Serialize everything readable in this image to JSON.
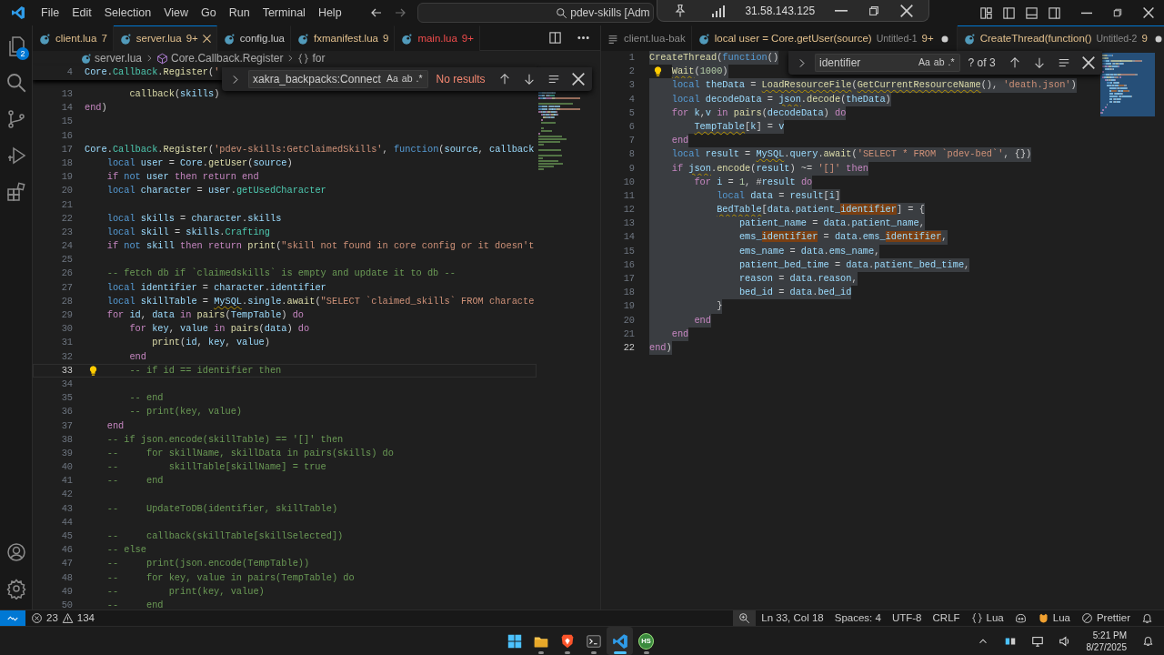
{
  "title_bar": {
    "menu": [
      "File",
      "Edit",
      "Selection",
      "View",
      "Go",
      "Run",
      "Terminal",
      "Help"
    ],
    "search": "pdev-skills [Adm"
  },
  "remote_toolbar": {
    "address": "31.58.143.125"
  },
  "activity_bar": {
    "items": [
      {
        "kind": "explorer",
        "badge": "2"
      },
      {
        "kind": "search"
      },
      {
        "kind": "scm"
      },
      {
        "kind": "debug"
      },
      {
        "kind": "extensions"
      }
    ],
    "bottom": [
      {
        "kind": "account"
      },
      {
        "kind": "settings"
      }
    ]
  },
  "left_editor": {
    "tabs": [
      {
        "kind": "warning",
        "label": "client.lua",
        "badge": "7",
        "modified": false,
        "selected": false
      },
      {
        "kind": "warning",
        "label": "server.lua",
        "badge": "9+",
        "modified": false,
        "selected": true
      },
      {
        "kind": "clean",
        "label": "config.lua",
        "modified": false,
        "selected": false
      },
      {
        "kind": "warning",
        "label": "fxmanifest.lua",
        "badge": "9",
        "modified": false,
        "selected": false
      },
      {
        "kind": "error",
        "label": "main.lua",
        "badge": "9+",
        "modified": false,
        "selected": false
      }
    ],
    "breadcrumb": [
      {
        "kind": "file",
        "label": "server.lua"
      },
      {
        "kind": "class",
        "label": "Core.Callback.Register"
      },
      {
        "kind": "block",
        "label": "for"
      }
    ],
    "find": {
      "query": "xakra_backpacks:Connect",
      "options": [
        "Aa",
        "ab",
        ".*"
      ],
      "status": "No results",
      "found": false
    },
    "selection": false,
    "sticky": {
      "num": "4",
      "current": false,
      "bulb": false,
      "t": [
        {
          "kind": "var",
          "text": "Core"
        },
        {
          "kind": "pun",
          "text": "."
        },
        {
          "kind": "mem",
          "text": "Callback"
        },
        {
          "kind": "pun",
          "text": "."
        },
        {
          "kind": "fn",
          "text": "Register"
        },
        {
          "kind": "pun",
          "text": "("
        },
        {
          "kind": "str",
          "text": "'"
        }
      ]
    },
    "lines": [
      {
        "num": "13",
        "current": false,
        "bulb": false,
        "t": [
          {
            "kind": "fn",
            "text": "        callback"
          },
          {
            "kind": "pun",
            "text": "("
          },
          {
            "kind": "var",
            "text": "skills"
          },
          {
            "kind": "pun",
            "text": ")"
          }
        ]
      },
      {
        "num": "14",
        "current": false,
        "bulb": false,
        "t": [
          {
            "kind": "kw",
            "text": "end"
          },
          {
            "kind": "pun",
            "text": ")"
          }
        ]
      },
      {
        "num": "15",
        "current": false,
        "bulb": false
      },
      {
        "num": "16",
        "current": false,
        "bulb": false
      },
      {
        "num": "17",
        "current": false,
        "bulb": false,
        "t": [
          {
            "kind": "var",
            "text": "Core"
          },
          {
            "kind": "pun",
            "text": "."
          },
          {
            "kind": "mem",
            "text": "Callback"
          },
          {
            "kind": "pun",
            "text": "."
          },
          {
            "kind": "fn",
            "text": "Register"
          },
          {
            "kind": "pun",
            "text": "("
          },
          {
            "kind": "str",
            "text": "'pdev-skills:GetClaimedSkills'"
          },
          {
            "kind": "pun",
            "text": ", "
          },
          {
            "kind": "st",
            "text": "function"
          },
          {
            "kind": "pun",
            "text": "("
          },
          {
            "kind": "var",
            "text": "source"
          },
          {
            "kind": "pun",
            "text": ", "
          },
          {
            "kind": "var",
            "text": "callback"
          }
        ]
      },
      {
        "num": "18",
        "current": false,
        "bulb": false,
        "t": [
          {
            "kind": "st",
            "text": "    local "
          },
          {
            "kind": "var",
            "text": "user"
          },
          {
            "kind": "pun",
            "text": " = "
          },
          {
            "kind": "var",
            "text": "Core"
          },
          {
            "kind": "pun",
            "text": "."
          },
          {
            "kind": "fn",
            "text": "getUser"
          },
          {
            "kind": "pun",
            "text": "("
          },
          {
            "kind": "var",
            "text": "source"
          },
          {
            "kind": "pun",
            "text": ")"
          }
        ]
      },
      {
        "num": "19",
        "current": false,
        "bulb": false,
        "t": [
          {
            "kind": "kw",
            "text": "    if "
          },
          {
            "kind": "st",
            "text": "not "
          },
          {
            "kind": "var",
            "text": "user "
          },
          {
            "kind": "kw",
            "text": "then return end"
          }
        ]
      },
      {
        "num": "20",
        "current": false,
        "bulb": false,
        "t": [
          {
            "kind": "st",
            "text": "    local "
          },
          {
            "kind": "var",
            "text": "character"
          },
          {
            "kind": "pun",
            "text": " = "
          },
          {
            "kind": "var",
            "text": "user"
          },
          {
            "kind": "pun",
            "text": "."
          },
          {
            "kind": "mem",
            "text": "getUsedCharacter"
          }
        ]
      },
      {
        "num": "21",
        "current": false,
        "bulb": false
      },
      {
        "num": "22",
        "current": false,
        "bulb": false,
        "t": [
          {
            "kind": "st",
            "text": "    local "
          },
          {
            "kind": "var",
            "text": "skills"
          },
          {
            "kind": "pun",
            "text": " = "
          },
          {
            "kind": "var",
            "text": "character"
          },
          {
            "kind": "pun",
            "text": "."
          },
          {
            "kind": "var",
            "text": "skills"
          }
        ]
      },
      {
        "num": "23",
        "current": false,
        "bulb": false,
        "t": [
          {
            "kind": "st",
            "text": "    local "
          },
          {
            "kind": "var",
            "text": "skill"
          },
          {
            "kind": "pun",
            "text": " = "
          },
          {
            "kind": "var",
            "text": "skills"
          },
          {
            "kind": "pun",
            "text": "."
          },
          {
            "kind": "mem",
            "text": "Crafting"
          }
        ]
      },
      {
        "num": "24",
        "current": false,
        "bulb": false,
        "t": [
          {
            "kind": "kw",
            "text": "    if "
          },
          {
            "kind": "st",
            "text": "not "
          },
          {
            "kind": "var",
            "text": "skill "
          },
          {
            "kind": "kw",
            "text": "then return "
          },
          {
            "kind": "fn",
            "text": "print"
          },
          {
            "kind": "pun",
            "text": "("
          },
          {
            "kind": "str",
            "text": "\"skill not found in core config or it doesn't"
          }
        ]
      },
      {
        "num": "25",
        "current": false,
        "bulb": false
      },
      {
        "num": "26",
        "current": false,
        "bulb": false,
        "t": [
          {
            "kind": "com",
            "text": "    -- fetch db if `claimedskills` is empty and update it to db --"
          }
        ]
      },
      {
        "num": "27",
        "current": false,
        "bulb": false,
        "t": [
          {
            "kind": "st",
            "text": "    local "
          },
          {
            "kind": "var",
            "text": "identifier"
          },
          {
            "kind": "pun",
            "text": " = "
          },
          {
            "kind": "var",
            "text": "character"
          },
          {
            "kind": "pun",
            "text": "."
          },
          {
            "kind": "var",
            "text": "identifier"
          }
        ]
      },
      {
        "num": "28",
        "current": false,
        "bulb": false,
        "t": [
          {
            "kind": "st",
            "text": "    local "
          },
          {
            "kind": "var",
            "text": "skillTable"
          },
          {
            "kind": "pun",
            "text": " = "
          },
          {
            "kind": "var",
            "text": "MySQL",
            "squiggle": true
          },
          {
            "kind": "pun",
            "text": "."
          },
          {
            "kind": "var",
            "text": "single"
          },
          {
            "kind": "pun",
            "text": "."
          },
          {
            "kind": "fn",
            "text": "await"
          },
          {
            "kind": "pun",
            "text": "("
          },
          {
            "kind": "str",
            "text": "\"SELECT `claimed_skills` FROM characte"
          }
        ]
      },
      {
        "num": "29",
        "current": false,
        "bulb": false,
        "t": [
          {
            "kind": "kw",
            "text": "    for "
          },
          {
            "kind": "var",
            "text": "id"
          },
          {
            "kind": "pun",
            "text": ", "
          },
          {
            "kind": "var",
            "text": "data "
          },
          {
            "kind": "kw",
            "text": "in "
          },
          {
            "kind": "fn",
            "text": "pairs"
          },
          {
            "kind": "pun",
            "text": "("
          },
          {
            "kind": "var",
            "text": "TempTable"
          },
          {
            "kind": "pun",
            "text": ") "
          },
          {
            "kind": "kw",
            "text": "do"
          }
        ]
      },
      {
        "num": "30",
        "current": false,
        "bulb": false,
        "t": [
          {
            "kind": "kw",
            "text": "        for "
          },
          {
            "kind": "var",
            "text": "key"
          },
          {
            "kind": "pun",
            "text": ", "
          },
          {
            "kind": "var",
            "text": "value "
          },
          {
            "kind": "kw",
            "text": "in "
          },
          {
            "kind": "fn",
            "text": "pairs"
          },
          {
            "kind": "pun",
            "text": "("
          },
          {
            "kind": "var",
            "text": "data"
          },
          {
            "kind": "pun",
            "text": ") "
          },
          {
            "kind": "kw",
            "text": "do"
          }
        ]
      },
      {
        "num": "31",
        "current": false,
        "bulb": false,
        "t": [
          {
            "kind": "fn",
            "text": "            print"
          },
          {
            "kind": "pun",
            "text": "("
          },
          {
            "kind": "var",
            "text": "id"
          },
          {
            "kind": "pun",
            "text": ", "
          },
          {
            "kind": "var",
            "text": "key"
          },
          {
            "kind": "pun",
            "text": ", "
          },
          {
            "kind": "var",
            "text": "value"
          },
          {
            "kind": "pun",
            "text": ")"
          }
        ]
      },
      {
        "num": "32",
        "current": false,
        "bulb": false,
        "t": [
          {
            "kind": "kw",
            "text": "        end"
          }
        ]
      },
      {
        "num": "33",
        "current": true,
        "bulb": true,
        "t": [
          {
            "kind": "com",
            "text": "        -- if id == identifier then"
          }
        ]
      },
      {
        "num": "34",
        "current": false,
        "bulb": false
      },
      {
        "num": "35",
        "current": false,
        "bulb": false,
        "t": [
          {
            "kind": "com",
            "text": "        -- end"
          }
        ]
      },
      {
        "num": "36",
        "current": false,
        "bulb": false,
        "t": [
          {
            "kind": "com",
            "text": "        -- print(key, value)"
          }
        ]
      },
      {
        "num": "37",
        "current": false,
        "bulb": false,
        "t": [
          {
            "kind": "kw",
            "text": "    end"
          }
        ]
      },
      {
        "num": "38",
        "current": false,
        "bulb": false,
        "t": [
          {
            "kind": "com",
            "text": "    -- if json.encode(skillTable) == '[]' then"
          }
        ]
      },
      {
        "num": "39",
        "current": false,
        "bulb": false,
        "t": [
          {
            "kind": "com",
            "text": "    --     for skillName, skillData in pairs(skills) do"
          }
        ]
      },
      {
        "num": "40",
        "current": false,
        "bulb": false,
        "t": [
          {
            "kind": "com",
            "text": "    --         skillTable[skillName] = true"
          }
        ]
      },
      {
        "num": "41",
        "current": false,
        "bulb": false,
        "t": [
          {
            "kind": "com",
            "text": "    --     end"
          }
        ]
      },
      {
        "num": "42",
        "current": false,
        "bulb": false
      },
      {
        "num": "43",
        "current": false,
        "bulb": false,
        "t": [
          {
            "kind": "com",
            "text": "    --     UpdateToDB(identifier, skillTable)"
          }
        ]
      },
      {
        "num": "44",
        "current": false,
        "bulb": false
      },
      {
        "num": "45",
        "current": false,
        "bulb": false,
        "t": [
          {
            "kind": "com",
            "text": "    --     callback(skillTable[skillSelected])"
          }
        ]
      },
      {
        "num": "46",
        "current": false,
        "bulb": false,
        "t": [
          {
            "kind": "com",
            "text": "    -- else"
          }
        ]
      },
      {
        "num": "47",
        "current": false,
        "bulb": false,
        "t": [
          {
            "kind": "com",
            "text": "    --     print(json.encode(TempTable))"
          }
        ]
      },
      {
        "num": "48",
        "current": false,
        "bulb": false,
        "t": [
          {
            "kind": "com",
            "text": "    --     for key, value in pairs(TempTable) do"
          }
        ]
      },
      {
        "num": "49",
        "current": false,
        "bulb": false,
        "t": [
          {
            "kind": "com",
            "text": "    --         print(key, value)"
          }
        ]
      },
      {
        "num": "50",
        "current": false,
        "bulb": false,
        "t": [
          {
            "kind": "com",
            "text": "    --     end"
          }
        ]
      }
    ]
  },
  "right_editor": {
    "tabs": [
      {
        "kind": "plain",
        "label": "client.lua-bak",
        "modified": false,
        "selected": false
      },
      {
        "kind": "warning",
        "label": "local user = Core.getUser(source)",
        "description": "Untitled-1",
        "badge": "9+",
        "modified": true,
        "selected": false
      },
      {
        "kind": "warning",
        "label": "CreateThread(function()",
        "description": "Untitled-2",
        "badge": "9",
        "modified": true,
        "selected": true
      }
    ],
    "find": {
      "query": "identifier",
      "options": [
        "Aa",
        "ab",
        ".*"
      ],
      "status": "? of 3",
      "found": true
    },
    "selection": true,
    "lines": [
      {
        "num": "1",
        "current": false,
        "bulb": false,
        "t": [
          {
            "kind": "fn",
            "text": "CreateThread"
          },
          {
            "kind": "pun",
            "text": "("
          },
          {
            "kind": "st",
            "text": "function"
          },
          {
            "kind": "pun",
            "text": "()"
          }
        ]
      },
      {
        "num": "2",
        "current": false,
        "bulb": true,
        "t": [
          {
            "kind": "fn",
            "text": "    Wait",
            "squiggle": true
          },
          {
            "kind": "pun",
            "text": "("
          },
          {
            "kind": "num",
            "text": "1000"
          },
          {
            "kind": "pun",
            "text": ")"
          }
        ]
      },
      {
        "num": "3",
        "current": false,
        "bulb": false,
        "t": [
          {
            "kind": "st",
            "text": "    local "
          },
          {
            "kind": "var",
            "text": "theData"
          },
          {
            "kind": "pun",
            "text": " = "
          },
          {
            "kind": "fn",
            "text": "LoadResourceFile",
            "squiggle": true
          },
          {
            "kind": "pun",
            "text": "("
          },
          {
            "kind": "fn",
            "text": "GetCurrentResourceName",
            "squiggle": true
          },
          {
            "kind": "pun",
            "text": "(), "
          },
          {
            "kind": "str",
            "text": "'death.json'"
          },
          {
            "kind": "pun",
            "text": ")"
          }
        ]
      },
      {
        "num": "4",
        "current": false,
        "bulb": false,
        "t": [
          {
            "kind": "st",
            "text": "    local "
          },
          {
            "kind": "var",
            "text": "decodeData"
          },
          {
            "kind": "pun",
            "text": " = "
          },
          {
            "kind": "var",
            "text": "json",
            "squiggle": true
          },
          {
            "kind": "pun",
            "text": "."
          },
          {
            "kind": "fn",
            "text": "decode"
          },
          {
            "kind": "pun",
            "text": "("
          },
          {
            "kind": "var",
            "text": "theData"
          },
          {
            "kind": "pun",
            "text": ")"
          }
        ]
      },
      {
        "num": "5",
        "current": false,
        "bulb": false,
        "t": [
          {
            "kind": "kw",
            "text": "    for "
          },
          {
            "kind": "var",
            "text": "k"
          },
          {
            "kind": "pun",
            "text": ","
          },
          {
            "kind": "var",
            "text": "v "
          },
          {
            "kind": "kw",
            "text": "in "
          },
          {
            "kind": "fn",
            "text": "pairs"
          },
          {
            "kind": "pun",
            "text": "("
          },
          {
            "kind": "var",
            "text": "decodeData"
          },
          {
            "kind": "pun",
            "text": ") "
          },
          {
            "kind": "kw",
            "text": "do"
          }
        ]
      },
      {
        "num": "6",
        "current": false,
        "bulb": false,
        "t": [
          {
            "kind": "var",
            "text": "        TempTable",
            "squiggle": true
          },
          {
            "kind": "pun",
            "text": "["
          },
          {
            "kind": "var",
            "text": "k"
          },
          {
            "kind": "pun",
            "text": "] = "
          },
          {
            "kind": "var",
            "text": "v"
          }
        ]
      },
      {
        "num": "7",
        "current": false,
        "bulb": false,
        "t": [
          {
            "kind": "kw",
            "text": "    end"
          }
        ]
      },
      {
        "num": "8",
        "current": false,
        "bulb": false,
        "t": [
          {
            "kind": "st",
            "text": "    local "
          },
          {
            "kind": "var",
            "text": "result"
          },
          {
            "kind": "pun",
            "text": " = "
          },
          {
            "kind": "var",
            "text": "MySQL",
            "squiggle": true
          },
          {
            "kind": "pun",
            "text": "."
          },
          {
            "kind": "var",
            "text": "query"
          },
          {
            "kind": "pun",
            "text": "."
          },
          {
            "kind": "fn",
            "text": "await"
          },
          {
            "kind": "pun",
            "text": "("
          },
          {
            "kind": "str",
            "text": "'SELECT * FROM `pdev-bed`'"
          },
          {
            "kind": "pun",
            "text": ", {})"
          }
        ]
      },
      {
        "num": "9",
        "current": false,
        "bulb": false,
        "t": [
          {
            "kind": "kw",
            "text": "    if "
          },
          {
            "kind": "var",
            "text": "json",
            "squiggle": true
          },
          {
            "kind": "pun",
            "text": "."
          },
          {
            "kind": "fn",
            "text": "encode"
          },
          {
            "kind": "pun",
            "text": "("
          },
          {
            "kind": "var",
            "text": "result"
          },
          {
            "kind": "pun",
            "text": ") ~= "
          },
          {
            "kind": "str",
            "text": "'[]'"
          },
          {
            "kind": "kw",
            "text": " then"
          }
        ]
      },
      {
        "num": "10",
        "current": false,
        "bulb": false,
        "t": [
          {
            "kind": "kw",
            "text": "        for "
          },
          {
            "kind": "var",
            "text": "i"
          },
          {
            "kind": "pun",
            "text": " = "
          },
          {
            "kind": "num",
            "text": "1"
          },
          {
            "kind": "pun",
            "text": ", #"
          },
          {
            "kind": "var",
            "text": "result "
          },
          {
            "kind": "kw",
            "text": "do"
          }
        ]
      },
      {
        "num": "11",
        "current": false,
        "bulb": false,
        "t": [
          {
            "kind": "st",
            "text": "            local "
          },
          {
            "kind": "var",
            "text": "data"
          },
          {
            "kind": "pun",
            "text": " = "
          },
          {
            "kind": "var",
            "text": "result"
          },
          {
            "kind": "pun",
            "text": "["
          },
          {
            "kind": "var",
            "text": "i"
          },
          {
            "kind": "pun",
            "text": "]"
          }
        ]
      },
      {
        "num": "12",
        "current": false,
        "bulb": false,
        "t": [
          {
            "kind": "var",
            "text": "            BedTable",
            "squiggle": true
          },
          {
            "kind": "pun",
            "text": "["
          },
          {
            "kind": "var",
            "text": "data"
          },
          {
            "kind": "pun",
            "text": "."
          },
          {
            "kind": "var",
            "text": "patient_"
          },
          {
            "kind": "hit",
            "text": "identifier"
          },
          {
            "kind": "pun",
            "text": "] = {"
          }
        ]
      },
      {
        "num": "13",
        "current": false,
        "bulb": false,
        "t": [
          {
            "kind": "var",
            "text": "                patient_name"
          },
          {
            "kind": "pun",
            "text": " = "
          },
          {
            "kind": "var",
            "text": "data"
          },
          {
            "kind": "pun",
            "text": "."
          },
          {
            "kind": "var",
            "text": "patient_name"
          },
          {
            "kind": "pun",
            "text": ","
          }
        ]
      },
      {
        "num": "14",
        "current": false,
        "bulb": false,
        "t": [
          {
            "kind": "var",
            "text": "                ems_"
          },
          {
            "kind": "hit",
            "text": "identifier"
          },
          {
            "kind": "pun",
            "text": " = "
          },
          {
            "kind": "var",
            "text": "data"
          },
          {
            "kind": "pun",
            "text": "."
          },
          {
            "kind": "var",
            "text": "ems_"
          },
          {
            "kind": "hit",
            "text": "identifier"
          },
          {
            "kind": "pun",
            "text": ","
          }
        ]
      },
      {
        "num": "15",
        "current": false,
        "bulb": false,
        "t": [
          {
            "kind": "var",
            "text": "                ems_name"
          },
          {
            "kind": "pun",
            "text": " = "
          },
          {
            "kind": "var",
            "text": "data"
          },
          {
            "kind": "pun",
            "text": "."
          },
          {
            "kind": "var",
            "text": "ems_name"
          },
          {
            "kind": "pun",
            "text": ","
          }
        ]
      },
      {
        "num": "16",
        "current": false,
        "bulb": false,
        "t": [
          {
            "kind": "var",
            "text": "                patient_bed_time"
          },
          {
            "kind": "pun",
            "text": " = "
          },
          {
            "kind": "var",
            "text": "data"
          },
          {
            "kind": "pun",
            "text": "."
          },
          {
            "kind": "var",
            "text": "patient_bed_time"
          },
          {
            "kind": "pun",
            "text": ","
          }
        ]
      },
      {
        "num": "17",
        "current": false,
        "bulb": false,
        "t": [
          {
            "kind": "var",
            "text": "                reason"
          },
          {
            "kind": "pun",
            "text": " = "
          },
          {
            "kind": "var",
            "text": "data"
          },
          {
            "kind": "pun",
            "text": "."
          },
          {
            "kind": "var",
            "text": "reason"
          },
          {
            "kind": "pun",
            "text": ","
          }
        ]
      },
      {
        "num": "18",
        "current": false,
        "bulb": false,
        "t": [
          {
            "kind": "var",
            "text": "                bed_id"
          },
          {
            "kind": "pun",
            "text": " = "
          },
          {
            "kind": "var",
            "text": "data"
          },
          {
            "kind": "pun",
            "text": "."
          },
          {
            "kind": "var",
            "text": "bed_id"
          }
        ]
      },
      {
        "num": "19",
        "current": false,
        "bulb": false,
        "t": [
          {
            "kind": "pun",
            "text": "            }"
          }
        ]
      },
      {
        "num": "20",
        "current": false,
        "bulb": false,
        "t": [
          {
            "kind": "kw",
            "text": "        end"
          }
        ]
      },
      {
        "num": "21",
        "current": false,
        "bulb": false,
        "t": [
          {
            "kind": "kw",
            "text": "    end"
          }
        ]
      },
      {
        "num": "22",
        "current": true,
        "bulb": false,
        "t": [
          {
            "kind": "kw",
            "text": "end"
          },
          {
            "kind": "pun",
            "text": ")"
          }
        ]
      }
    ]
  },
  "status_bar": {
    "errors": "23",
    "warnings": "134",
    "items": [
      {
        "kind": "zoom"
      },
      {
        "kind": "text",
        "text": "Ln 33, Col 18"
      },
      {
        "kind": "text",
        "text": "Spaces: 4"
      },
      {
        "kind": "text",
        "text": "UTF-8"
      },
      {
        "kind": "text",
        "text": "CRLF"
      },
      {
        "kind": "language",
        "text": "Lua"
      },
      {
        "kind": "copilot"
      },
      {
        "kind": "lua",
        "text": "Lua"
      },
      {
        "kind": "prettier",
        "text": "Prettier"
      },
      {
        "kind": "bell"
      }
    ]
  },
  "taskbar": {
    "apps": [
      {
        "kind": "start",
        "selected": false
      },
      {
        "kind": "files",
        "selected": false
      },
      {
        "kind": "browser",
        "selected": false
      },
      {
        "kind": "terminal",
        "selected": false
      },
      {
        "kind": "vscode",
        "selected": true
      },
      {
        "kind": "hs",
        "label": "HS",
        "selected": false
      }
    ],
    "time": "5:21 PM",
    "date": "8/27/2025"
  }
}
